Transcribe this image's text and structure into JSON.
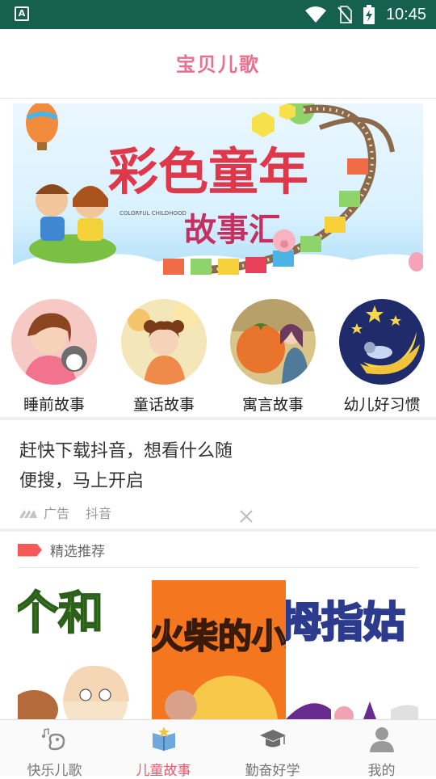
{
  "status_bar": {
    "time": "10:45",
    "notification_icon": "a-icon"
  },
  "header": {
    "title": "宝贝儿歌"
  },
  "banner": {
    "art_text_main": "彩色童年",
    "art_text_sub": "故事汇",
    "art_text_small": "COLORFUL CHILDHOOD"
  },
  "categories": [
    {
      "label": "睡前故事",
      "icon": "girl-with-cat"
    },
    {
      "label": "童话故事",
      "icon": "girl-with-bear"
    },
    {
      "label": "寓言故事",
      "icon": "girl-with-persimmon"
    },
    {
      "label": "幼儿好习惯",
      "icon": "moon-stars"
    }
  ],
  "ad": {
    "text": "赶快下载抖音，想看什么随便搜，马上开启",
    "text_line1": "赶快下载抖音，想看什么随",
    "text_line2": "便搜，马上开启",
    "ad_label": "广告",
    "source": "抖音",
    "close": "×"
  },
  "featured": {
    "title": "精选推荐",
    "items": [
      {
        "title_art": "个和"
      },
      {
        "title_art": "火柴的小女"
      },
      {
        "title_art": "拇指姑"
      }
    ]
  },
  "tabbar": {
    "tabs": [
      {
        "label": "快乐儿歌",
        "icon": "music-note-bird-icon",
        "active": false
      },
      {
        "label": "儿童故事",
        "icon": "storybook-icon",
        "active": true
      },
      {
        "label": "勤奋好学",
        "icon": "graduation-cap-icon",
        "active": false
      },
      {
        "label": "我的",
        "icon": "user-icon",
        "active": false
      }
    ]
  },
  "colors": {
    "status_bar": "#15604f",
    "accent": "#f0566b",
    "tag": "#f35b5b",
    "title_pink": "#e9718f"
  }
}
